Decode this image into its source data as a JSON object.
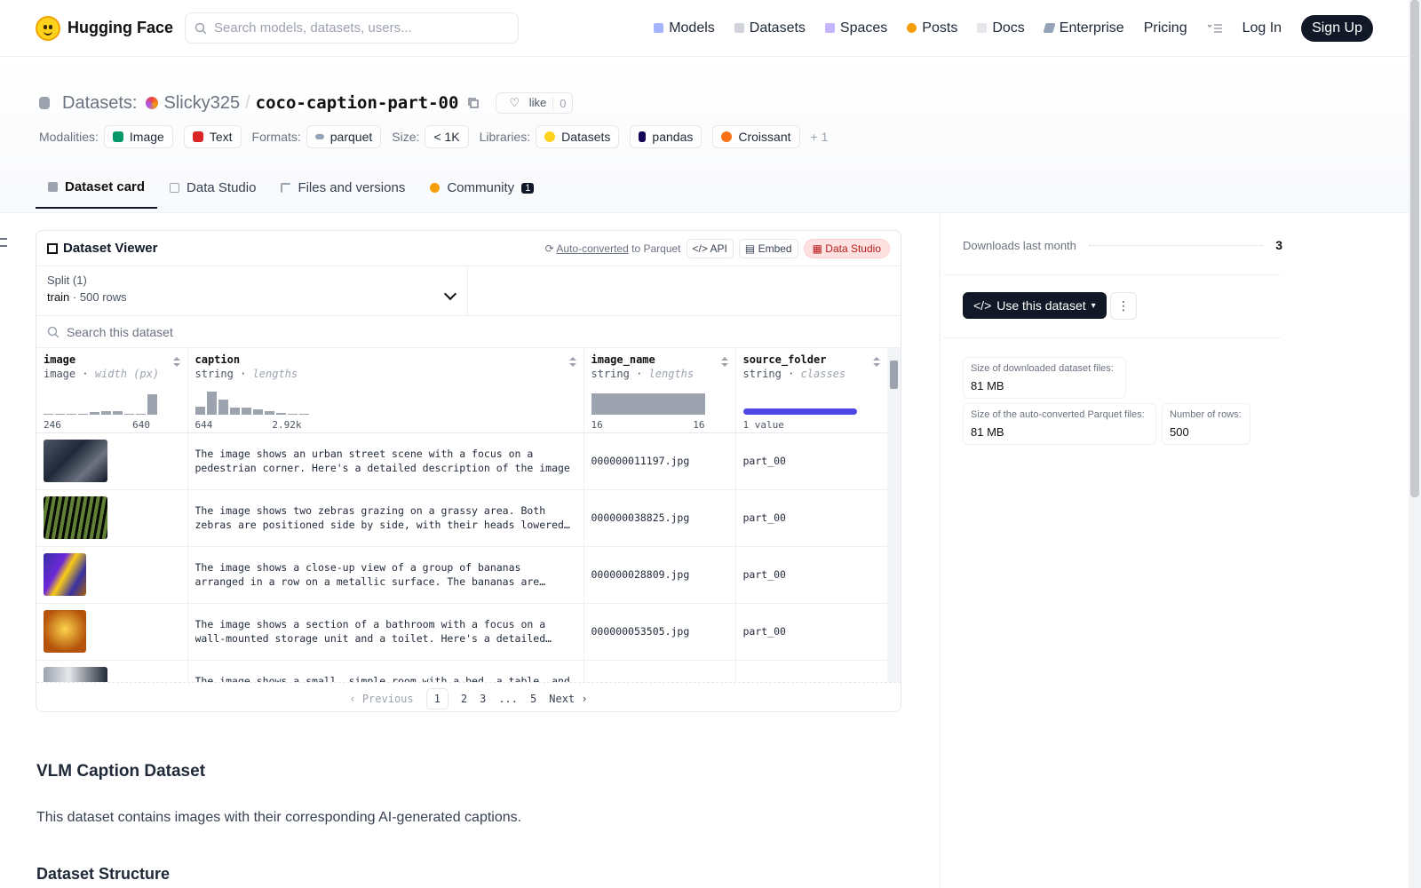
{
  "nav": {
    "brand": "Hugging Face",
    "search_placeholder": "Search models, datasets, users...",
    "links": [
      "Models",
      "Datasets",
      "Spaces",
      "Posts",
      "Docs",
      "Enterprise",
      "Pricing"
    ],
    "login": "Log In",
    "signup": "Sign Up"
  },
  "header": {
    "section": "Datasets:",
    "owner": "Slicky325",
    "sep": "/",
    "repo": "coco-caption-part-00",
    "like_label": "like",
    "like_count": "0",
    "modalities_label": "Modalities:",
    "modalities": [
      "Image",
      "Text"
    ],
    "formats_label": "Formats:",
    "format": "parquet",
    "size_label": "Size:",
    "size": "< 1K",
    "libraries_label": "Libraries:",
    "libraries": [
      "Datasets",
      "pandas",
      "Croissant"
    ],
    "more": "+ 1"
  },
  "tabs": [
    {
      "label": "Dataset card",
      "active": true
    },
    {
      "label": "Data Studio"
    },
    {
      "label": "Files and versions"
    },
    {
      "label": "Community",
      "badge": "1"
    }
  ],
  "viewer": {
    "title": "Dataset Viewer",
    "auto_converted": "Auto-converted",
    "to_parquet": "to Parquet",
    "api": "API",
    "embed": "Embed",
    "data_studio": "Data Studio",
    "split_label": "Split (1)",
    "split_name": "train",
    "split_rows": "500 rows",
    "search_placeholder": "Search this dataset",
    "columns": [
      {
        "name": "image",
        "type": "image",
        "stat": "width (px)",
        "min": "246",
        "max": "640"
      },
      {
        "name": "caption",
        "type": "string",
        "stat": "lengths",
        "min": "644",
        "max": "2.92k"
      },
      {
        "name": "image_name",
        "type": "string",
        "stat": "lengths",
        "min": "16",
        "max": "16"
      },
      {
        "name": "source_folder",
        "type": "string",
        "stat": "classes",
        "min": "1 value",
        "max": ""
      }
    ],
    "histograms": {
      "image": [
        0.04,
        0.04,
        0.04,
        0.04,
        0.12,
        0.15,
        0.15,
        0.04,
        0.04,
        0.9
      ],
      "caption": [
        0.35,
        1.0,
        0.65,
        0.3,
        0.3,
        0.22,
        0.16,
        0.06,
        0.04,
        0.04
      ]
    },
    "rows": [
      {
        "caption": "The image shows an urban street scene with a focus on a pedestrian corner. Here's a detailed description of the image",
        "image_name": "000000011197.jpg",
        "source_folder": "part_00",
        "thumb": "street"
      },
      {
        "caption": "The image shows two zebras grazing on a grassy area. Both zebras are positioned side by side, with their heads lowered to the grass",
        "image_name": "000000038825.jpg",
        "source_folder": "part_00",
        "thumb": "zebra"
      },
      {
        "caption": "The image shows a close-up view of a group of bananas arranged in a row on a metallic surface. The bananas are yellow with brown spots",
        "image_name": "000000028809.jpg",
        "source_folder": "part_00",
        "thumb": "banana"
      },
      {
        "caption": "The image shows a section of a bathroom with a focus on a wall-mounted storage unit and a toilet. Here's a detailed description",
        "image_name": "000000053505.jpg",
        "source_folder": "part_00",
        "thumb": "bathroom"
      },
      {
        "caption": "The image shows a small, simple room with a bed, a table, and a chair.",
        "image_name": "",
        "source_folder": "",
        "thumb": "room"
      }
    ],
    "pager": {
      "prev": "Previous",
      "pages": [
        "1",
        "2",
        "3",
        "...",
        "5"
      ],
      "next": "Next"
    }
  },
  "card": {
    "heading": "VLM Caption Dataset",
    "paragraph": "This dataset contains images with their corresponding AI-generated captions.",
    "heading2": "Dataset Structure"
  },
  "sidebar": {
    "downloads_label": "Downloads last month",
    "downloads_value": "3",
    "use_button": "Use this dataset",
    "stats": [
      {
        "label": "Size of downloaded dataset files:",
        "value": "81 MB"
      },
      {
        "label": "Size of the auto-converted Parquet files:",
        "value": "81 MB"
      },
      {
        "label": "Number of rows:",
        "value": "500"
      }
    ]
  },
  "colors": {
    "accent": "#111827",
    "class_bar": "#4f46e5",
    "hist": "#9ca3af"
  }
}
